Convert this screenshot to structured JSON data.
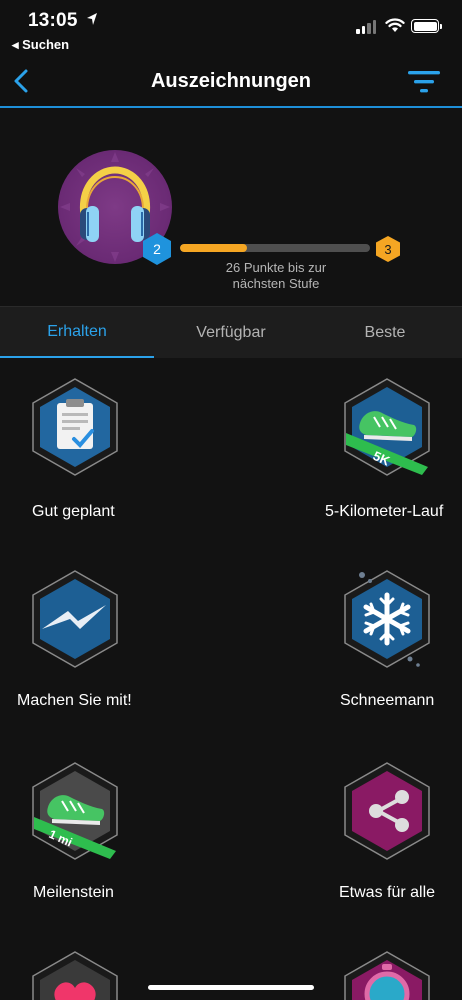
{
  "status_bar": {
    "time": "13:05",
    "back_app": "◂ Suchen"
  },
  "nav": {
    "title": "Auszeichnungen",
    "icons": {
      "back": "chevron-left-icon",
      "filter": "filter-icon"
    },
    "accent": "#1e8fd8"
  },
  "level": {
    "current": "2",
    "next": "3",
    "progress": 0.35,
    "caption_line1": "26 Punkte bis zur",
    "caption_line2": "nächsten Stufe",
    "avatar_icon": "headphones-icon",
    "colors": {
      "current": "#1f93dd",
      "next": "#f5a623",
      "avatar_bg": "#6f2d79"
    }
  },
  "tabs": [
    {
      "label": "Erhalten",
      "active": true
    },
    {
      "label": "Verfügbar",
      "active": false
    },
    {
      "label": "Beste",
      "active": false
    }
  ],
  "badges": [
    {
      "label": "Gut geplant",
      "icon": "clipboard-check-icon"
    },
    {
      "label": "5-Kilometer-Lauf",
      "icon": "running-shoe-icon",
      "ribbon": "5K"
    },
    {
      "label": "Machen Sie mit!",
      "icon": "messenger-bolt-icon"
    },
    {
      "label": "Schneemann",
      "icon": "snowflake-icon"
    },
    {
      "label": "Meilenstein",
      "icon": "running-shoe-icon",
      "ribbon": "1 mi"
    },
    {
      "label": "Etwas für alle",
      "icon": "share-icon"
    }
  ]
}
